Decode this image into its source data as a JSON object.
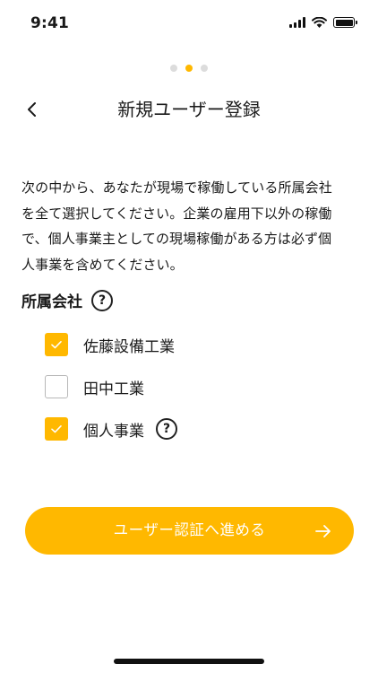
{
  "status_bar": {
    "time": "9:41"
  },
  "stepper": {
    "total": 3,
    "current": 2
  },
  "header": {
    "title": "新規ユーザー登録"
  },
  "description": {
    "lines": [
      "次の中から、あなたが現場で稼働している所属会社",
      "を全て選択してください。企業の雇用下以外の稼働",
      "で、個人事業主としての現場稼働がある方は必ず個",
      "人事業を含めてください。"
    ]
  },
  "section": {
    "title": "所属会社",
    "help": "?"
  },
  "options": [
    {
      "label": "佐藤設備工業",
      "checked": true
    },
    {
      "label": "田中工業",
      "checked": false
    },
    {
      "label": "個人事業",
      "checked": true,
      "help": "?"
    }
  ],
  "cta": {
    "label": "ユーザー認証へ進める"
  },
  "colors": {
    "accent": "#ffb800",
    "checkbox_border": "#b8b8b8",
    "text": "#1a1a1a"
  }
}
